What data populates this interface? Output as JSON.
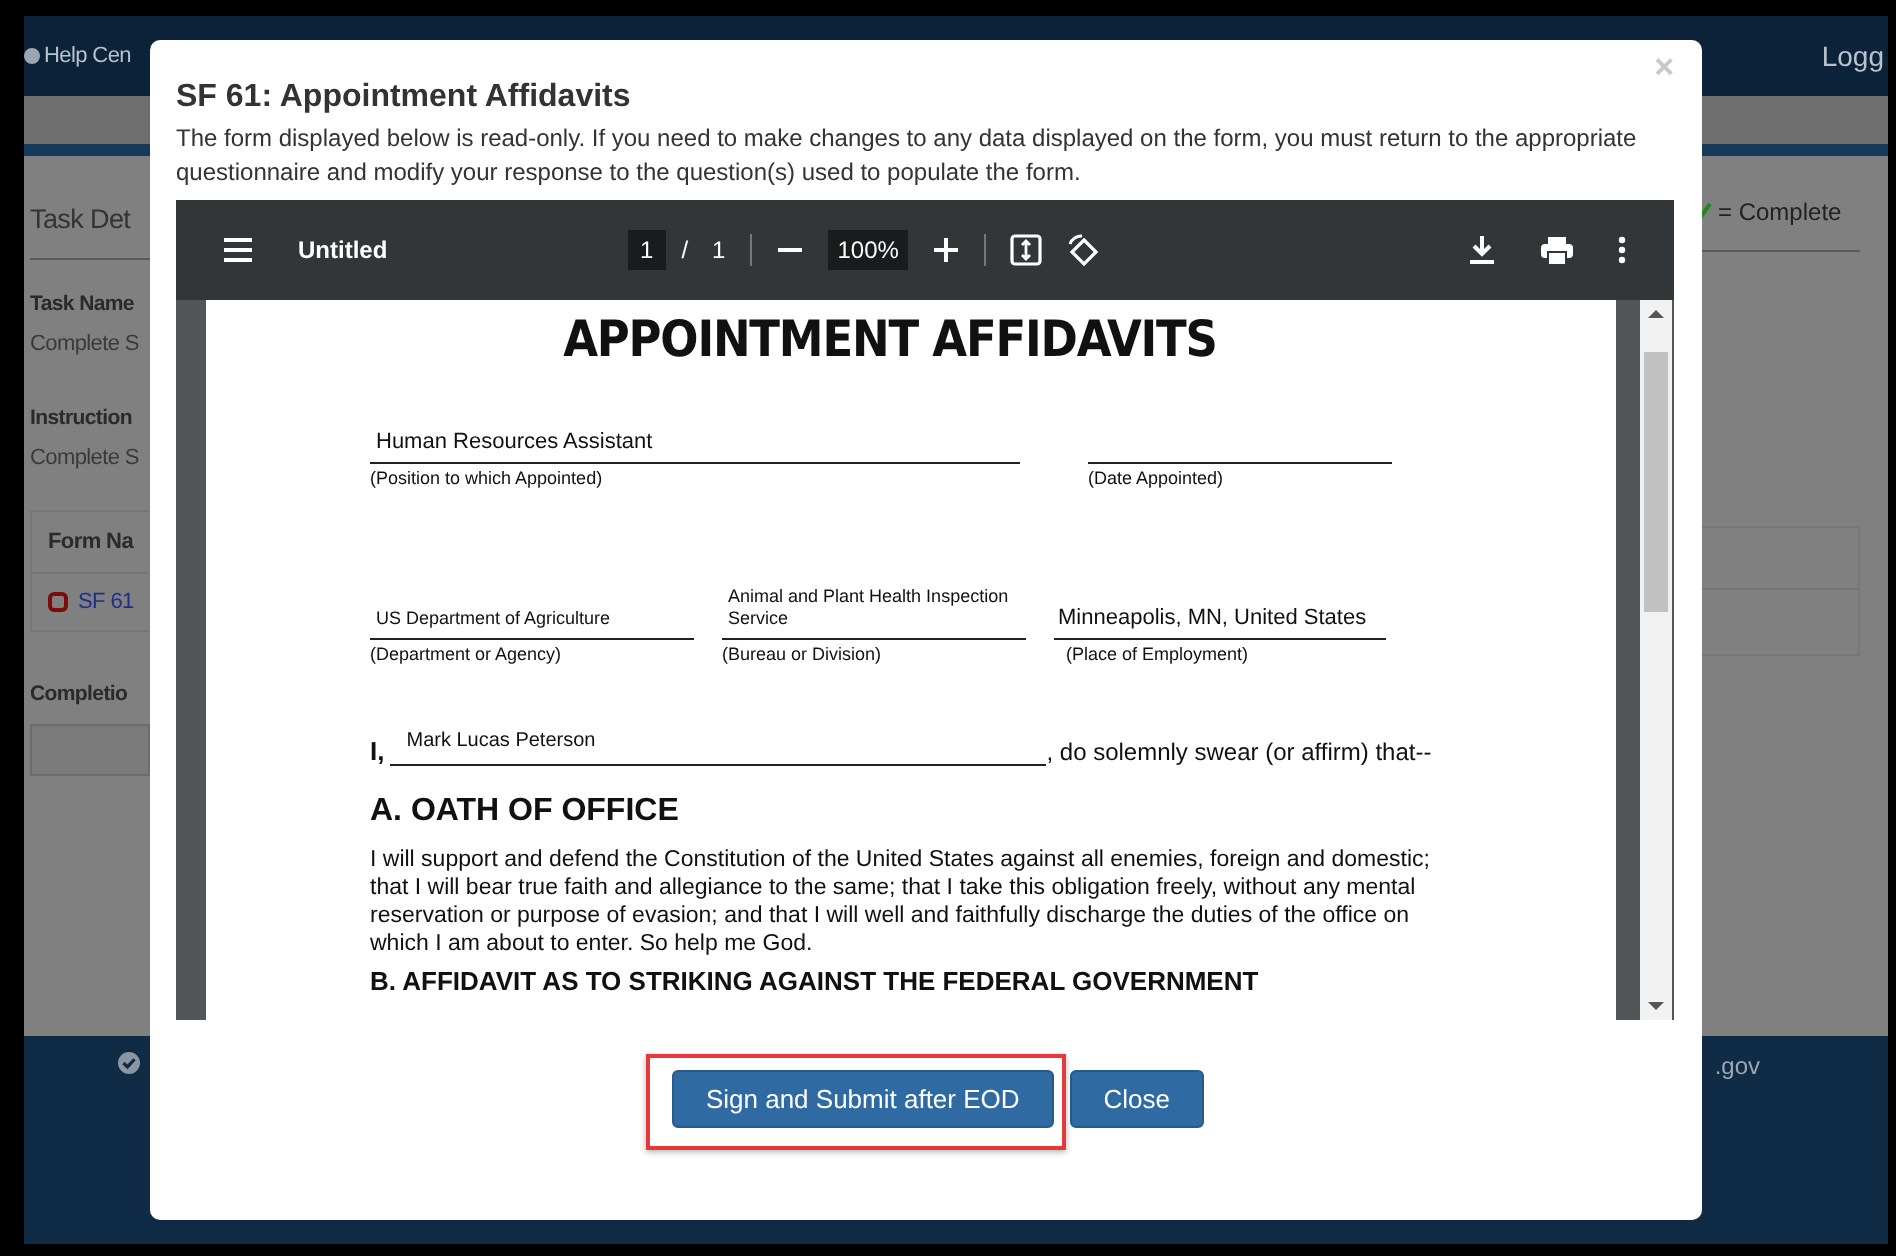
{
  "background_page": {
    "nav": {
      "help_link": "Help Cen",
      "login_link": "Logg"
    },
    "heading": "Task Det",
    "task_name_label": "Task Name",
    "task_name_value": "Complete S",
    "instructions_label": "Instruction",
    "instructions_value": "Complete S",
    "forms_table": {
      "column_1": "Form Na",
      "rows": [
        {
          "form": "SF 61",
          "complete": false
        }
      ]
    },
    "completion_label": "Completio",
    "legend": {
      "label": "= Complete"
    },
    "footer": {
      "text": ".gov"
    }
  },
  "modal": {
    "close_symbol": "×",
    "title": "SF 61: Appointment Affidavits",
    "description": "The form displayed below is read-only. If you need to make changes to any data displayed on the form, you must return to the appropriate questionnaire and modify your response to the question(s) used to populate the form.",
    "pdf_viewer": {
      "file_name": "Untitled",
      "page": "1",
      "page_separator": "/",
      "page_count": "1",
      "zoom": "100%",
      "document": {
        "title": "APPOINTMENT AFFIDAVITS",
        "field_rows": [
          [
            {
              "value": "Human Resources Assistant",
              "label": "(Position to which Appointed)"
            },
            {
              "label": "(Date Appointed)"
            }
          ],
          [
            {
              "value": "US Department of Agriculture",
              "label": "(Department or Agency)"
            },
            {
              "value": "Animal and Plant Health Inspection Service",
              "label": "(Bureau or Division)"
            },
            {
              "value": "Minneapolis, MN, United States",
              "label": "(Place of Employment)"
            }
          ]
        ],
        "oath_prefix": "I,",
        "oath_name": "Mark  Lucas  Peterson",
        "oath_suffix": ", do solemnly swear (or affirm) that--",
        "section_a_title": "A. OATH OF OFFICE",
        "section_a_text": "I will support and defend the Constitution of the United States against all enemies, foreign and domestic; that I will bear true faith and allegiance to the same; that I take this obligation freely, without any mental reservation or purpose of evasion; and that I will well and faithfully discharge the duties of the office on which  I am about to enter. So help me God.",
        "section_b_title": "B. AFFIDAVIT AS TO STRIKING AGAINST THE FEDERAL GOVERNMENT"
      }
    },
    "buttons": [
      {
        "label": "Sign and Submit after EOD",
        "highlighted": true
      },
      {
        "label": "Close",
        "highlighted": false
      }
    ]
  }
}
